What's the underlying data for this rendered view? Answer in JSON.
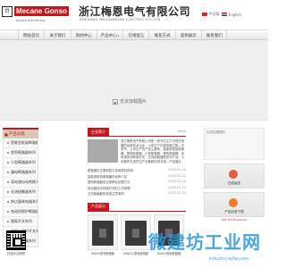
{
  "header": {
    "logo_mark": "台",
    "logo_text": "Mecane Gonso",
    "logo_sub": "MAKOR ELECTRICAL",
    "company_name": "浙江梅恩电气有限公司",
    "company_en": "ZHEJIANG MEILANHUAN ELECTRIC CO.,LTD",
    "lang_cn": "中文版",
    "lang_en": "English"
  },
  "nav": {
    "items": [
      {
        "label": "网站首页"
      },
      {
        "label": "关于我们"
      },
      {
        "label": "新闻中心"
      },
      {
        "label": "产品中心",
        "caret": true
      },
      {
        "label": "在线留言"
      },
      {
        "label": "联系方式"
      },
      {
        "label": "案例展示"
      },
      {
        "label": "联系我们"
      }
    ]
  },
  "banner": {
    "image_alt": "无法加载图片"
  },
  "categories": {
    "title": "产品分类",
    "items": [
      "智能型框架断路器",
      "塑壳断路器系列",
      "小型断路器系列",
      "漏电断路器系列",
      "双电源自动转换开关",
      "交流接触器系列",
      "热过载继电器系列",
      "电动机保护断路器",
      "隔离开关系列",
      "控制与保护开关系列",
      "电涌保护器系列"
    ]
  },
  "qr": {
    "caption": "扫描关注梅恩"
  },
  "contact_side": {
    "tab": "联系方式",
    "phone_label": "服务热线"
  },
  "about": {
    "tab": "企业简介",
    "more": "more",
    "text": "浙江梅恩电气有限公司是一家专业生产中低压电器的高新技术企业，公司位于中国电器之都—乐清市。公司生产的产品主要有：智能型框架断路器、塑壳断路器、小型断路器、漏电断路器、双电源自动转换开关、交流接触器等系列产品。公司拥有先进的生产设备和检测手段，产品通过CCC认证。"
  },
  "news": {
    "items": [
      {
        "title": "断路器的主要参数与选用原则说明",
        "date": "2020-02-14"
      },
      {
        "title": "智能型框架断路器的优势介绍",
        "date": "2020-02-14"
      },
      {
        "title": "塑壳断路器常见故障及处理方法",
        "date": "2020-02-14"
      },
      {
        "title": "双电源自动转换开关的工作原理",
        "date": "2020-02-14"
      },
      {
        "title": "交流接触器的选型注意事项",
        "date": "2020-02-14"
      }
    ]
  },
  "products": {
    "tab": "产品展示",
    "items": [
      {
        "name": "MGM1塑壳断路器"
      },
      {
        "name": "MGM1L漏电断路器"
      },
      {
        "name": "MGW1框架断路器"
      }
    ]
  },
  "right": {
    "no_image": "无法加载图片",
    "online_label": "在线留言",
    "download_label": "产品目录下载",
    "download_sub": "PDF File Download"
  },
  "watermark": {
    "text": "微建坊工业网",
    "sub": "industry.wjfw.com"
  }
}
